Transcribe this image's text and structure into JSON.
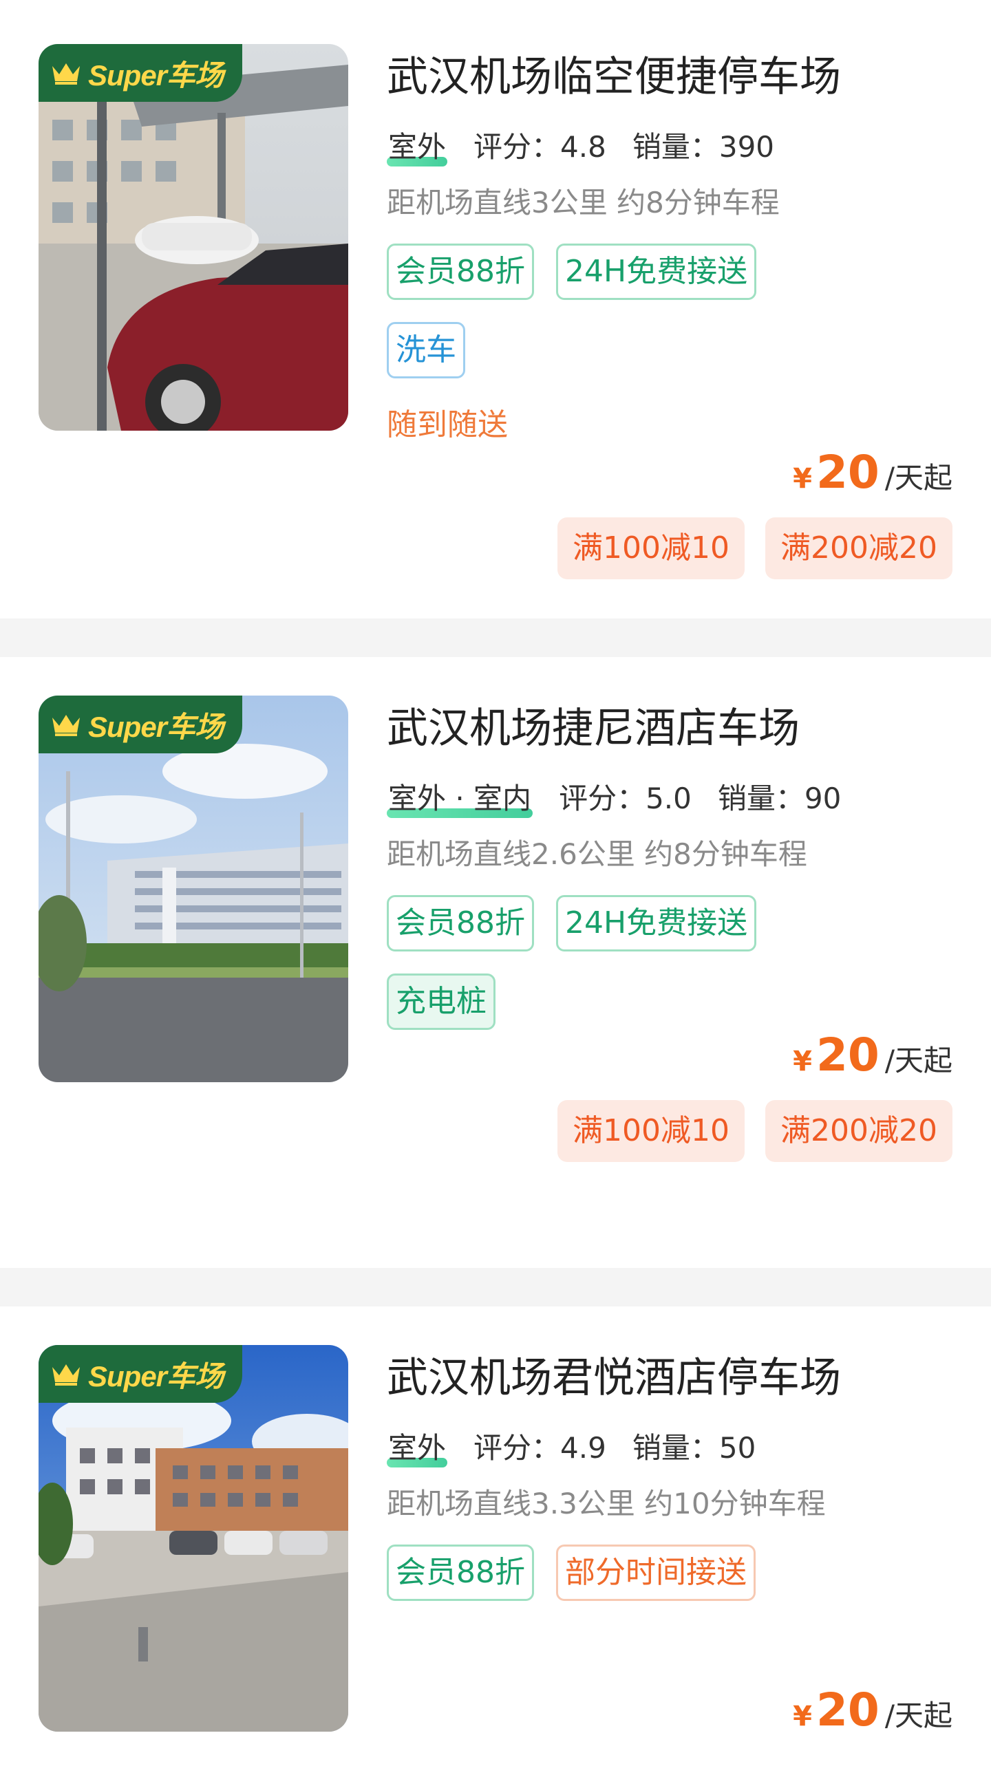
{
  "badge_text": "Super车场",
  "colors": {
    "accent_orange": "#f26a1b",
    "tag_green": "#18a06b",
    "tag_blue": "#2693d6",
    "badge_green": "#1e6b3c",
    "badge_text": "#ffd84a"
  },
  "lots": [
    {
      "name": "武汉机场临空便捷停车场",
      "type": "室外",
      "rating_label": "评分：",
      "rating": "4.8",
      "sales_label": "销量：",
      "sales": "390",
      "distance": "距机场直线3公里 约8分钟车程",
      "tags": [
        "会员88折",
        "24H免费接送"
      ],
      "tags_row2": [
        "洗车"
      ],
      "note": "随到随送",
      "price_symbol": "¥",
      "price": "20",
      "price_unit": "/天起",
      "coupons": [
        "满100减10",
        "满200减20"
      ],
      "image_icon": "parking-lot-photo-red-car"
    },
    {
      "name": "武汉机场捷尼酒店车场",
      "type": "室外 · 室内",
      "rating_label": "评分：",
      "rating": "5.0",
      "sales_label": "销量：",
      "sales": "90",
      "distance": "距机场直线2.6公里 约8分钟车程",
      "tags": [
        "会员88折",
        "24H免费接送"
      ],
      "tags_row2": [
        "充电桩"
      ],
      "price_symbol": "¥",
      "price": "20",
      "price_unit": "/天起",
      "coupons": [
        "满100减10",
        "满200减20"
      ],
      "image_icon": "parking-lot-photo-building"
    },
    {
      "name": "武汉机场君悦酒店停车场",
      "type": "室外",
      "rating_label": "评分：",
      "rating": "4.9",
      "sales_label": "销量：",
      "sales": "50",
      "distance": "距机场直线3.3公里 约10分钟车程",
      "tags": [
        "会员88折"
      ],
      "tags_orange": [
        "部分时间接送"
      ],
      "price_symbol": "¥",
      "price": "20",
      "price_unit": "/天起",
      "image_icon": "parking-lot-photo-hotel"
    }
  ]
}
